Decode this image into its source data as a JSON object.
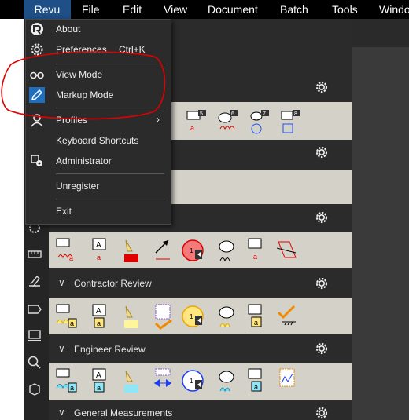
{
  "menu_bar": {
    "items": [
      "Revu",
      "File",
      "Edit",
      "View",
      "Document",
      "Batch",
      "Tools",
      "Windo"
    ]
  },
  "dropdown": {
    "about": "About",
    "preferences": "Preferences",
    "preferences_shortcut": "Ctrl+K",
    "view_mode": "View Mode",
    "markup_mode": "Markup Mode",
    "profiles": "Profiles",
    "keyboard_shortcuts": "Keyboard Shortcuts",
    "administrator": "Administrator",
    "unregister": "Unregister",
    "exit": "Exit"
  },
  "tool_sets": {
    "sections": [
      {
        "name": "Contractor Review"
      },
      {
        "name": "Engineer Review"
      },
      {
        "name": "General Measurements"
      }
    ],
    "badges": [
      "5",
      "6",
      "7",
      "8"
    ]
  },
  "colors": {
    "accent": "#1e4f86",
    "annotation_red": "#e00000",
    "tray_bg": "#d4d2c8"
  }
}
